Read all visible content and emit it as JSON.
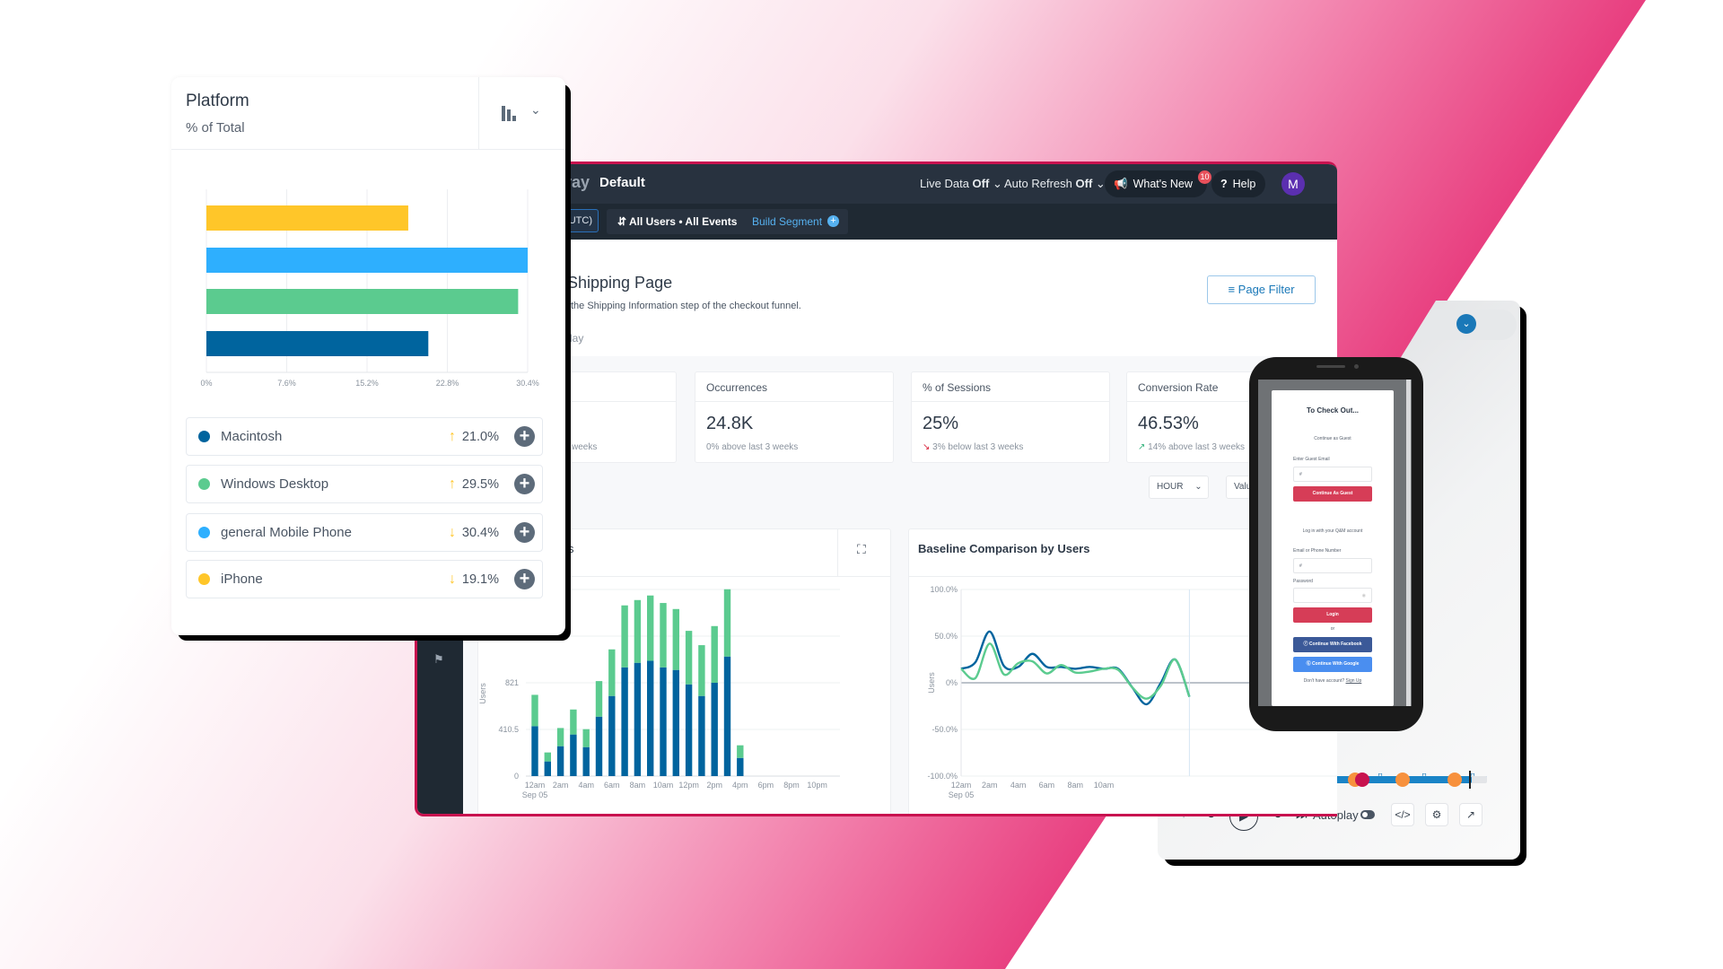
{
  "colors": {
    "macintosh": "#00649e",
    "windows": "#5bcb8f",
    "mobile": "#2eaffe",
    "iphone": "#ffc629",
    "brand_border": "#c8124f",
    "header": "#28323f",
    "pink": "#e83e7f"
  },
  "platform": {
    "title": "Platform",
    "subtitle": "% of Total",
    "chart_icon": "bar-chart-icon",
    "items": [
      {
        "name": "Macintosh",
        "value": "21.0%",
        "trend": "up",
        "color": "#00649e"
      },
      {
        "name": "Windows Desktop",
        "value": "29.5%",
        "trend": "up",
        "color": "#5bcb8f"
      },
      {
        "name": "general Mobile Phone",
        "value": "30.4%",
        "trend": "down",
        "color": "#2eaffe"
      },
      {
        "name": "iPhone",
        "value": "19.1%",
        "trend": "down",
        "color": "#ffc629"
      }
    ]
  },
  "header": {
    "brand_fragment": "ray",
    "project": "Default",
    "live_data_label": "Live Data",
    "live_data_value": "Off",
    "auto_refresh_label": "Auto Refresh",
    "auto_refresh_value": "Off",
    "whats_new": "What's New",
    "whats_new_badge": "10",
    "help": "Help",
    "avatar": "M"
  },
  "subheader": {
    "timezone_fragment": "UTC)",
    "segment": "All Users • All Events",
    "build_segment": "Build Segment"
  },
  "page": {
    "title_fragment": "Shipping Page",
    "description_fragment": "the Shipping Information step of the checkout funnel.",
    "tab_fragment": "lay",
    "page_filter": "Page Filter"
  },
  "metrics": [
    {
      "label": "",
      "value": "",
      "note": "weeks"
    },
    {
      "label": "Occurrences",
      "value": "24.8K",
      "note": "0% above last 3 weeks",
      "trend": "none"
    },
    {
      "label": "% of Sessions",
      "value": "25%",
      "note": "3% below last 3 weeks",
      "trend": "down"
    },
    {
      "label": "Conversion Rate",
      "value": "46.53%",
      "note": "14% above last 3 weeks",
      "trend": "up"
    }
  ],
  "controls": {
    "interval": "HOUR",
    "value_fragment": "Valu"
  },
  "chart_data": [
    {
      "type": "bar",
      "title": "Platform",
      "subtitle": "% of Total",
      "orientation": "horizontal",
      "categories": [
        "iPhone",
        "general Mobile Phone",
        "Windows Desktop",
        "Macintosh"
      ],
      "values": [
        19.1,
        30.4,
        29.5,
        21.0
      ],
      "colors": [
        "#ffc629",
        "#2eaffe",
        "#5bcb8f",
        "#00649e"
      ],
      "xticks": [
        "0%",
        "7.6%",
        "15.2%",
        "22.8%",
        "30.4%"
      ],
      "xlim": [
        0,
        30.4
      ],
      "grid": true
    },
    {
      "type": "bar",
      "stacked": true,
      "title_fragment": "s",
      "ylabel": "Users",
      "categories": [
        "12am",
        "1am",
        "2am",
        "3am",
        "4am",
        "5am",
        "6am",
        "7am",
        "8am",
        "9am",
        "10am",
        "11am",
        "12pm",
        "1pm",
        "2pm",
        "3pm",
        "4pm",
        "5pm",
        "6pm",
        "7pm",
        "8pm",
        "9pm",
        "10pm"
      ],
      "xtick_labels": [
        "12am",
        "2am",
        "4am",
        "6am",
        "8am",
        "10am",
        "12pm",
        "2pm",
        "4pm",
        "6pm",
        "8pm",
        "10pm"
      ],
      "xsub": "Sep 05",
      "series": [
        {
          "color": "#00649e",
          "values": [
            439,
            129,
            263,
            366,
            255,
            523,
            705,
            957,
            997,
            1015,
            957,
            934,
            807,
            705,
            821,
            1052,
            160,
            0,
            0,
            0,
            0,
            0,
            0
          ]
        },
        {
          "color": "#5bcb8f",
          "values": [
            276,
            79,
            160,
            220,
            158,
            313,
            410,
            545,
            552,
            574,
            566,
            536,
            471,
            447,
            499,
            592,
            111,
            0,
            0,
            0,
            0,
            0,
            0
          ]
        }
      ],
      "yticks": [
        "0",
        "410.5",
        "821"
      ],
      "ylim": [
        0,
        1642
      ],
      "grid": true
    },
    {
      "type": "line",
      "title": "Baseline Comparison by Users",
      "ylabel": "Users",
      "x": [
        "12am",
        "1am",
        "2am",
        "3am",
        "4am",
        "5am",
        "6am",
        "7am",
        "8am",
        "9am",
        "10am",
        "11am",
        "12pm",
        "1pm",
        "2pm",
        "3pm",
        "4pm"
      ],
      "xtick_labels": [
        "12am",
        "2am",
        "4am",
        "6am",
        "8am",
        "10am"
      ],
      "xsub": "Sep 05",
      "series": [
        {
          "color": "#00649e",
          "values": [
            15,
            22,
            55,
            18,
            17,
            31,
            17,
            17,
            15,
            17,
            15,
            15,
            -5,
            -23,
            0,
            25,
            -15
          ]
        },
        {
          "color": "#5bcb8f",
          "values": [
            15,
            5,
            42,
            9,
            21,
            23,
            10,
            19,
            11,
            12,
            15,
            14,
            -5,
            -17,
            -3,
            25,
            -15
          ]
        }
      ],
      "yticks": [
        "100.0%",
        "50.0%",
        "0%",
        "-50.0%",
        "-100.0%"
      ],
      "ylim": [
        -100,
        100
      ],
      "grid": true
    }
  ],
  "phone": {
    "title": "To Check Out...",
    "guest_label": "Continue as Guest",
    "guest_email_label": "Enter Guest Email",
    "guest_email_value": "#",
    "guest_button": "Continue As Guest",
    "login_heading": "Log in with your Q&M account",
    "email_label": "Email or Phone Number",
    "email_value": "#",
    "password_label": "Password",
    "login_button": "Login",
    "or": "or",
    "facebook_button": "Continue With Facebook",
    "google_button": "Continue With Google",
    "no_account": "Don't have account?",
    "sign_up": "Sign Up"
  },
  "player": {
    "autoplay": "Autoplay",
    "autoplay_on": false,
    "progress": 0.95
  }
}
